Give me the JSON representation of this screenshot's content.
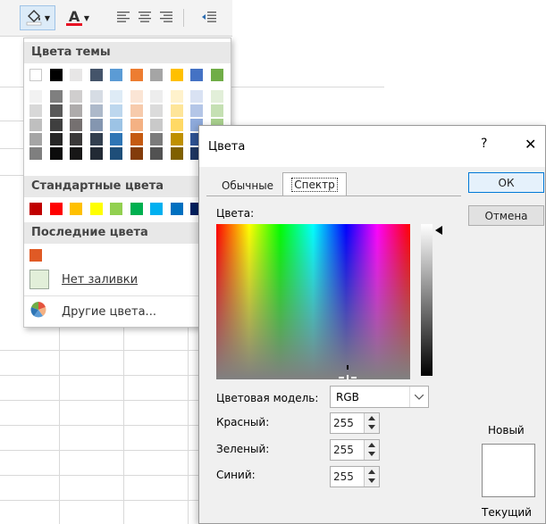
{
  "ribbon": {
    "fill_icon": "paint-bucket-icon",
    "font_color_icon": "font-color-icon",
    "font_color_letter": "A",
    "align_left_icon": "align-left-icon",
    "align_center_icon": "align-center-icon",
    "align_right_icon": "align-right-icon",
    "decrease_indent_icon": "decrease-indent-icon",
    "accent_red": "#e81123"
  },
  "palette": {
    "theme_title": "Цвета темы",
    "theme_top": [
      "#ffffff",
      "#000000",
      "#e7e6e6",
      "#44546a",
      "#5b9bd5",
      "#ed7d31",
      "#a5a5a5",
      "#ffc000",
      "#4472c4",
      "#70ad47"
    ],
    "theme_shades": [
      [
        "#f2f2f2",
        "#7f7f7f",
        "#d0cece",
        "#d6dce4",
        "#deebf6",
        "#fbe5d5",
        "#ededed",
        "#fff2cc",
        "#d9e2f3",
        "#e2efd9"
      ],
      [
        "#d8d8d8",
        "#595959",
        "#aeabab",
        "#adb9ca",
        "#bdd7ee",
        "#f7cbac",
        "#dbdbdb",
        "#fee599",
        "#b4c6e7",
        "#c5e0b3"
      ],
      [
        "#bfbfbf",
        "#3f3f3f",
        "#757070",
        "#8496b0",
        "#9cc3e5",
        "#f4b183",
        "#c9c9c9",
        "#ffd965",
        "#8eaadb",
        "#a8d08d"
      ],
      [
        "#a5a5a5",
        "#262626",
        "#3a3838",
        "#323f4f",
        "#2e75b5",
        "#c55a11",
        "#7b7b7b",
        "#bf9000",
        "#2f5496",
        "#538135"
      ],
      [
        "#7f7f7f",
        "#0c0c0c",
        "#171616",
        "#222a35",
        "#1e4e79",
        "#833c0b",
        "#525252",
        "#7f6000",
        "#1f3864",
        "#375623"
      ]
    ],
    "standard_title": "Стандартные цвета",
    "standard": [
      "#c00000",
      "#ff0000",
      "#ffc000",
      "#ffff00",
      "#92d050",
      "#00b050",
      "#00b0f0",
      "#0070c0",
      "#002060",
      "#7030a0"
    ],
    "recent_title": "Последние цвета",
    "recent": [
      "#e05a25"
    ],
    "no_fill_label": "Нет заливки",
    "more_colors_label": "Другие цвета..."
  },
  "dialog": {
    "title": "Цвета",
    "help": "?",
    "close": "✕",
    "tab_standard": "Обычные",
    "tab_custom": "Спектр",
    "colors_label": "Цвета:",
    "ok_label": "ОК",
    "cancel_label": "Отмена",
    "model_label": "Цветовая модель:",
    "model_value": "RGB",
    "red_label": "Красный:",
    "green_label": "Зеленый:",
    "blue_label": "Синий:",
    "red_value": "255",
    "green_value": "255",
    "blue_value": "255",
    "new_label": "Новый",
    "current_label": "Текущий",
    "new_color": "#ffffff"
  }
}
